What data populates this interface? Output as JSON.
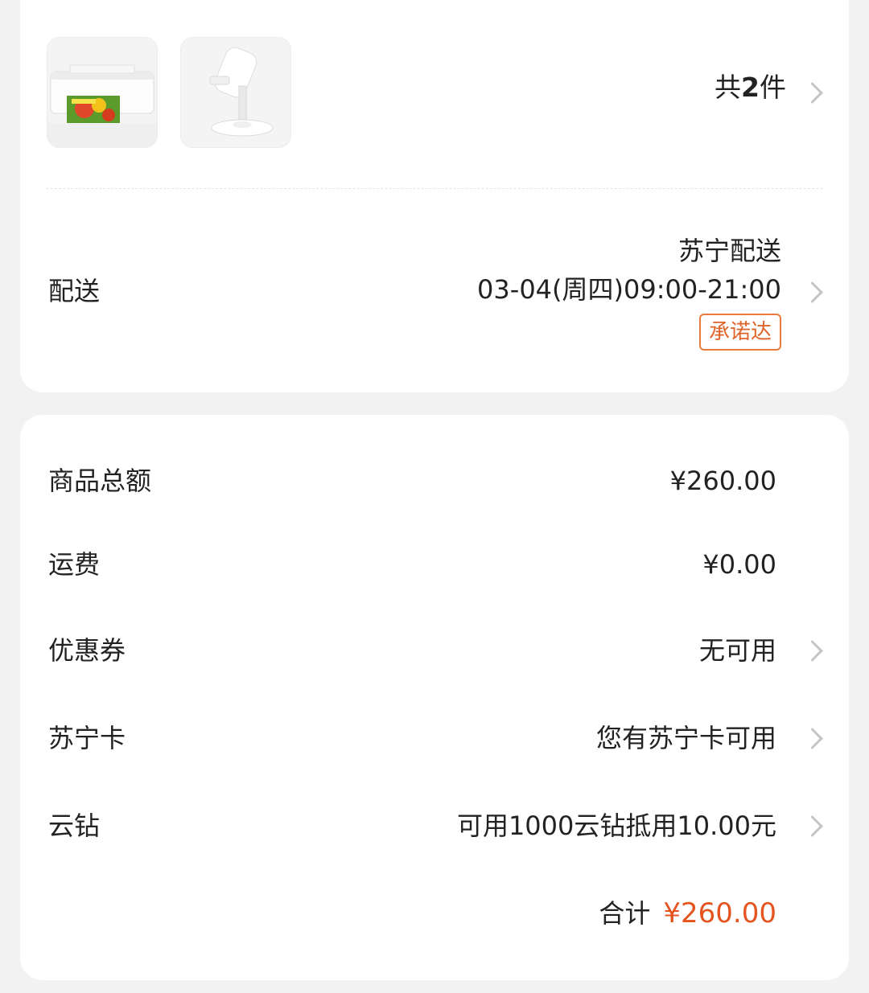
{
  "order_items": {
    "count_prefix": "共",
    "count_number": "2",
    "count_suffix": "件",
    "items": [
      {
        "name": "printer",
        "icon": "printer-image"
      },
      {
        "name": "phone-stand",
        "icon": "phone-stand-image"
      }
    ]
  },
  "delivery": {
    "label": "配送",
    "carrier": "苏宁配送",
    "time_window": "03-04(周四)09:00-21:00",
    "badge": "承诺达"
  },
  "summary": {
    "rows": [
      {
        "label": "商品总额",
        "value": "¥260.00"
      },
      {
        "label": "运费",
        "value": "¥0.00"
      },
      {
        "label": "优惠券",
        "value": "无可用"
      },
      {
        "label": "苏宁卡",
        "value": "您有苏宁卡可用"
      },
      {
        "label": "云钻",
        "value": "可用1000云钻抵用10.00元"
      }
    ],
    "total_label": "合计",
    "total_value": "¥260.00"
  },
  "colors": {
    "accent": "#e5531f",
    "badge_border": "#ec7a3c",
    "background": "#f2f2f2",
    "card": "#ffffff"
  }
}
